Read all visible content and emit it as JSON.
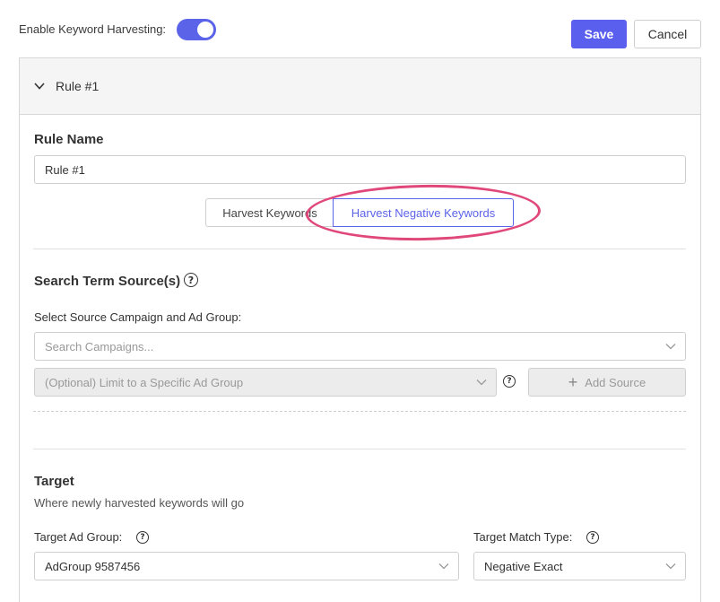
{
  "topbar": {
    "toggle_label": "Enable Keyword Harvesting:",
    "toggle_on": true,
    "save_label": "Save",
    "cancel_label": "Cancel"
  },
  "rule": {
    "header_title": "Rule #1",
    "name_label": "Rule Name",
    "name_value": "Rule #1",
    "tabs": [
      "Harvest Keywords",
      "Harvest Negative Keywords"
    ],
    "active_tab": "Harvest Negative Keywords"
  },
  "source": {
    "title": "Search Term Source(s)",
    "select_label": "Select Source Campaign and Ad Group:",
    "campaign_placeholder": "Search Campaigns...",
    "adgroup_placeholder": "(Optional) Limit to a Specific Ad Group",
    "add_source_label": "Add Source"
  },
  "target": {
    "title": "Target",
    "subtitle": "Where newly harvested keywords will go",
    "adgroup_label": "Target Ad Group:",
    "adgroup_value": "AdGroup 9587456",
    "match_type_label": "Target Match Type:",
    "match_type_value": "Negative Exact"
  },
  "icons": {
    "help": "?",
    "plus": "+"
  },
  "colors": {
    "accent": "#5b63e8",
    "highlight": "#e0487a"
  }
}
